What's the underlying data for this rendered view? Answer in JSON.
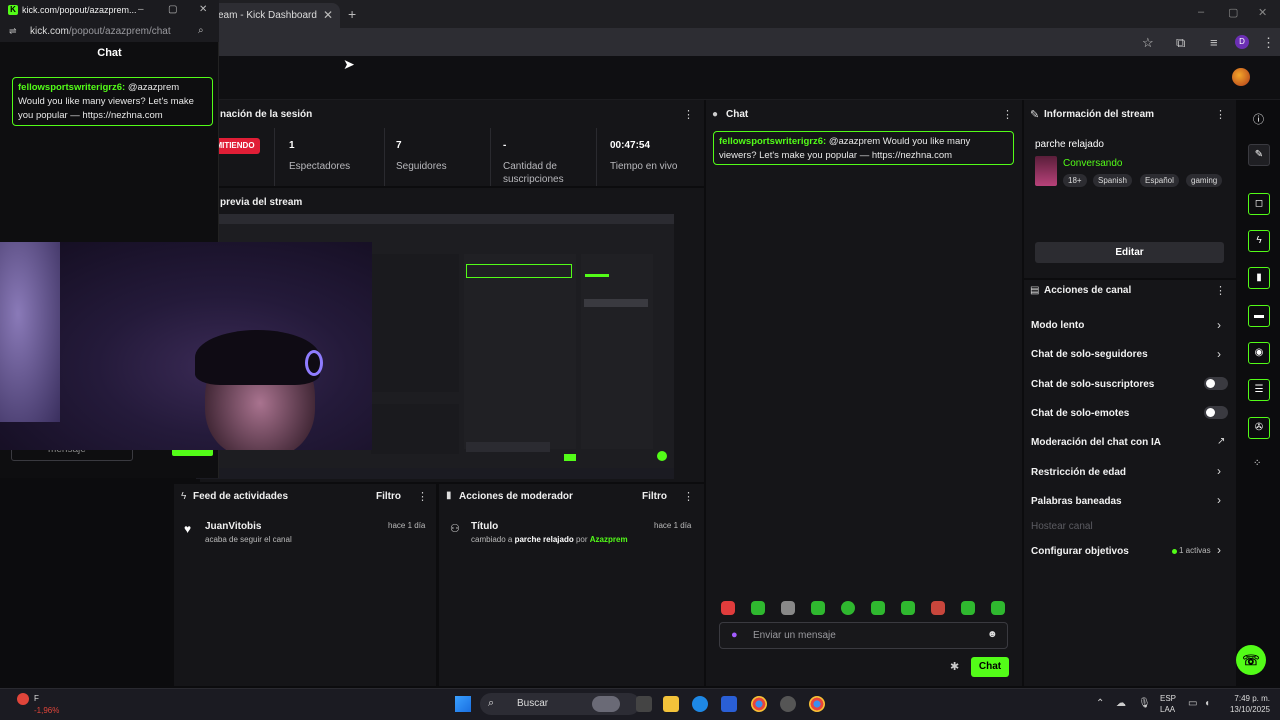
{
  "browser": {
    "tab_title": "eam - Kick Dashboard",
    "tab_close": "✕",
    "new_tab": "+",
    "window_controls": [
      "–",
      "▢",
      "✕"
    ],
    "profile_initial": "D"
  },
  "popout": {
    "title": "kick.com/popout/azazprem...",
    "url_domain": "kick.com",
    "url_path": "/popout/azazprem/chat",
    "heading": "Chat",
    "message": {
      "user": "fellowsportswriterigrz6:",
      "mention": "@azazprem",
      "text": "Would you like many viewers? Let's make you popular — https://nezhna.com"
    },
    "input_placeholder": "mensaje"
  },
  "session": {
    "title": "nación de la sesión",
    "live_badge": "MITIENDO",
    "stats": [
      {
        "value": "1",
        "label": "Espectadores"
      },
      {
        "value": "7",
        "label": "Seguidores"
      },
      {
        "value": "-",
        "label": "Cantidad de suscripciones"
      },
      {
        "value": "00:47:54",
        "label": "Tiempo en vivo"
      }
    ]
  },
  "preview": {
    "title": "previa del stream"
  },
  "chat": {
    "title": "Chat",
    "message": {
      "user": "fellowsportswriterigrz6:",
      "text": "@azazprem Would you like many viewers? Let's make you popular — https://nezhna.com"
    },
    "input_placeholder": "Enviar un mensaje",
    "send_label": "Chat"
  },
  "stream_info": {
    "title": "Información del stream",
    "stream_title": "parche relajado",
    "category": "Conversando",
    "tags": [
      "18+",
      "Spanish",
      "Español",
      "gaming"
    ],
    "edit_label": "Editar"
  },
  "channel_actions": {
    "title": "Acciones de canal",
    "items": [
      {
        "label": "Modo lento",
        "control": "chevron"
      },
      {
        "label": "Chat de solo-seguidores",
        "control": "chevron"
      },
      {
        "label": "Chat de solo-suscriptores",
        "control": "toggle"
      },
      {
        "label": "Chat de solo-emotes",
        "control": "toggle"
      },
      {
        "label": "Moderación del chat con IA",
        "control": "external"
      },
      {
        "label": "Restricción de edad",
        "control": "chevron"
      },
      {
        "label": "Palabras baneadas",
        "control": "chevron"
      }
    ],
    "host_label": "Hostear canal",
    "goals_label": "Configurar objetivos",
    "goals_status": "1 activas"
  },
  "activity_feed": {
    "title": "Feed de actividades",
    "filter_label": "Filtro",
    "item": {
      "user": "JuanVitobis",
      "time": "hace 1 día",
      "text": "acaba de seguir el canal"
    }
  },
  "mod_actions": {
    "title": "Acciones de moderador",
    "filter_label": "Filtro",
    "item": {
      "title": "Título",
      "time": "hace 1 día",
      "pre": "cambiado a",
      "value": "parche relajado",
      "by": "por",
      "user": "Azazprem"
    }
  },
  "taskbar": {
    "weather_temp": "F",
    "weather_change": "-1,96%",
    "search_label": "Buscar",
    "lang_top": "ESP",
    "lang_bottom": "LAA",
    "time": "7:49 p. m.",
    "date": "13/10/2025"
  },
  "colors": {
    "accent": "#53fc18",
    "live": "#e01e36"
  }
}
